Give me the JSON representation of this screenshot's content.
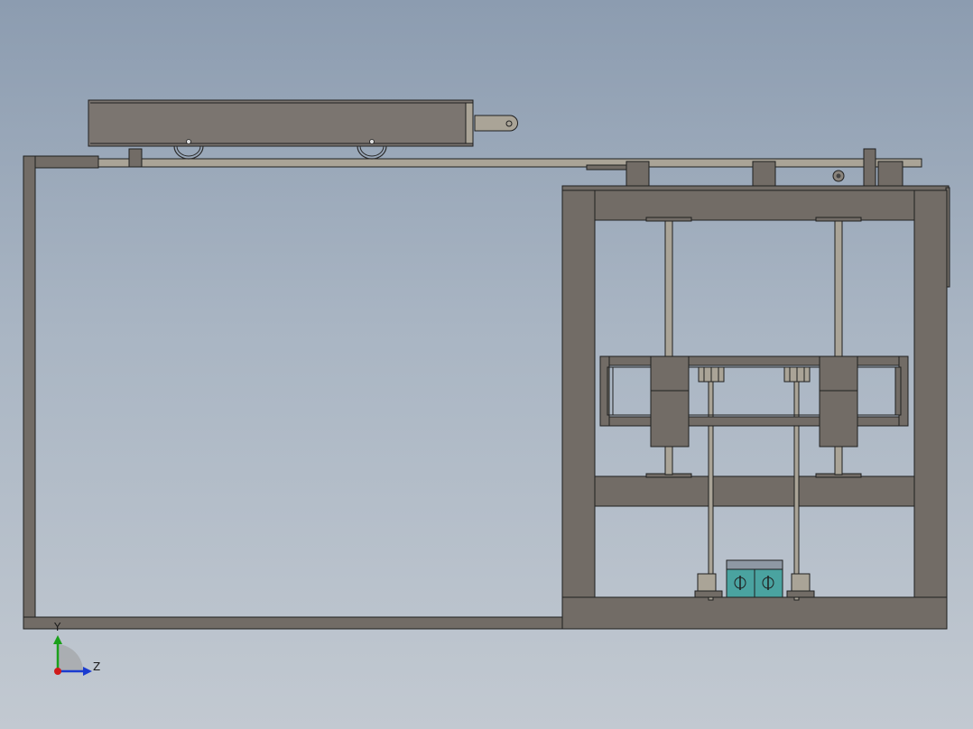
{
  "viewport": {
    "view_name": "Front",
    "background_top": "#8c9cb0",
    "background_bottom": "#c2c9d1"
  },
  "colors": {
    "steel": "#726c66",
    "steel_dark": "#5f5a55",
    "edge": "#1f1f1f",
    "rail": "#aaa497",
    "motor_body": "#7b7570",
    "sensor_teal": "#4aa3a0",
    "axis_y": "#1aa01a",
    "axis_z": "#1a3bd0",
    "axis_x": "#d01a1a"
  },
  "triad": {
    "label_y": "Y",
    "label_z": "Z",
    "icon": "coordinate-triad-icon"
  },
  "parts": [
    "outer-frame",
    "guide-rail",
    "linear-actuator",
    "lifting-cabinet",
    "guide-columns",
    "carriage-assembly",
    "middle-platform",
    "sensor-blocks"
  ]
}
